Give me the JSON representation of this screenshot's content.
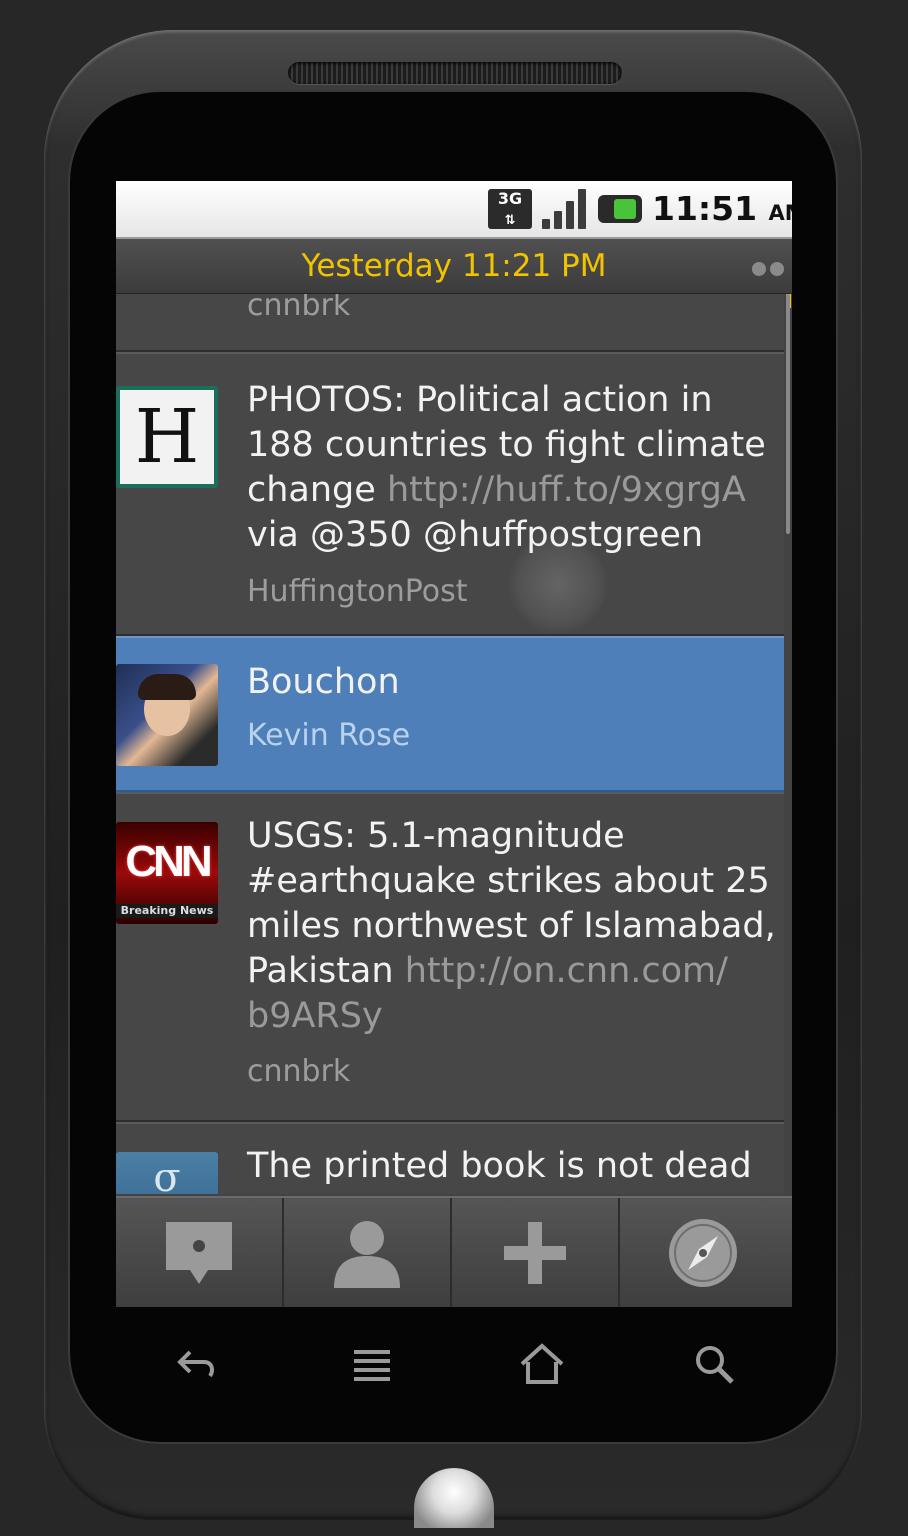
{
  "status_bar": {
    "network": "3G",
    "time": "11:51",
    "ampm": "AM"
  },
  "title_bar": {
    "timestamp": "Yesterday 11:21 PM"
  },
  "feed": {
    "partial_author": "cnnbrk",
    "tweets": [
      {
        "avatar_label": "H",
        "text": "PHOTOS: Political action in 188 countries to fight climate change",
        "link": "http://huff.to/9xgrgA",
        "suffix": "via @350 @huffpostgreen",
        "author": "HuffingtonPost"
      },
      {
        "text": "Bouchon",
        "author": "Kevin Rose",
        "selected": true
      },
      {
        "avatar_label": "CNN",
        "avatar_sublabel": "Breaking News",
        "text": "USGS: 5.1-magnitude #earthquake strikes about 25 miles northwest of Islamabad, Pakistan",
        "link": "http://on.cnn.com/ b9ARSy",
        "author": "cnnbrk"
      },
      {
        "avatar_label": "σ",
        "text": "The printed book is not dead"
      }
    ]
  },
  "tab_bar": {
    "tabs": [
      "messages-icon",
      "profile-icon",
      "add-icon",
      "explore-icon"
    ]
  },
  "softkeys": [
    "back-icon",
    "menu-icon",
    "home-icon",
    "search-icon"
  ],
  "colors": {
    "accent": "#f2c300",
    "selected_row": "#4f7fb8"
  }
}
